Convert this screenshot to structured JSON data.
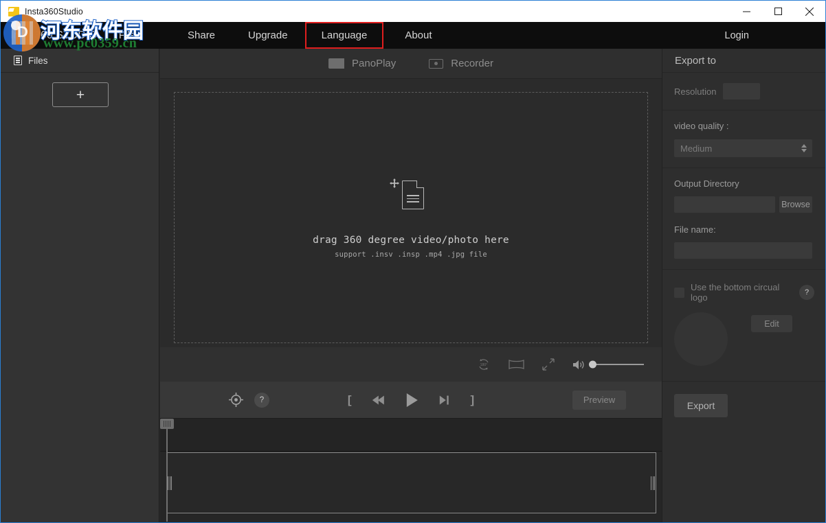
{
  "window": {
    "title": "Insta360Studio",
    "icon": "folder-icon",
    "controls": {
      "minimize": "minimize-icon",
      "maximize": "maximize-icon",
      "close": "close-icon"
    }
  },
  "menubar": {
    "brand": "Insta360 STUDIO",
    "items": [
      {
        "label": "File",
        "highlighted": false
      },
      {
        "label": "Share",
        "highlighted": false
      },
      {
        "label": "Upgrade",
        "highlighted": false
      },
      {
        "label": "Language",
        "highlighted": true
      },
      {
        "label": "About",
        "highlighted": false
      }
    ],
    "login_label": "Login",
    "highlight_color": "#e01e1e"
  },
  "sidebar": {
    "header_label": "Files",
    "header_icon": "list-icon",
    "add_button_label": "+"
  },
  "tabs": [
    {
      "label": "PanoPlay",
      "icon": "panorama-screen-icon",
      "active": false
    },
    {
      "label": "Recorder",
      "icon": "recorder-icon",
      "active": false
    }
  ],
  "dropzone": {
    "icon": "move-document-icon",
    "primary_text": "drag 360 degree video/photo here",
    "secondary_text": "support .insv .insp .mp4 .jpg file"
  },
  "viewbar": {
    "rotate_icon": "rotate-180-icon",
    "rotate_label": "180°",
    "projection_icon": "panorama-view-icon",
    "fullscreen_icon": "fullscreen-expand-icon",
    "volume_icon": "volume-icon",
    "volume_value": 0
  },
  "transport": {
    "reset_view_icon": "target-icon",
    "help_label": "?",
    "mark_in_label": "[",
    "prev_icon": "skip-back-icon",
    "play_icon": "play-icon",
    "next_icon": "skip-forward-icon",
    "mark_out_label": "]",
    "preview_label": "Preview"
  },
  "timeline": {
    "playhead_handle": "playhead-grip",
    "clip_left_handle": "trim-left-handle",
    "clip_right_handle": "trim-right-handle"
  },
  "export_panel": {
    "title": "Export to",
    "resolution_label": "Resolution",
    "resolution_value": "",
    "video_quality_label": "video quality :",
    "video_quality_value": "Medium",
    "video_quality_options": [
      "Medium"
    ],
    "output_directory_label": "Output Directory",
    "output_directory_value": "",
    "browse_label": "Browse",
    "file_name_label": "File name:",
    "file_name_value": "",
    "logo_checkbox_label": "Use the bottom circual logo",
    "logo_checkbox_checked": false,
    "logo_help_label": "?",
    "edit_label": "Edit",
    "export_label": "Export"
  },
  "watermark": {
    "chinese_text": "河东软件园",
    "url_text": "www.pc0359.cn",
    "logo_icon": "hedong-logo-icon",
    "text_color": "#ffffff",
    "outline_color": "#1f63c8",
    "url_color": "#1e7d32"
  }
}
